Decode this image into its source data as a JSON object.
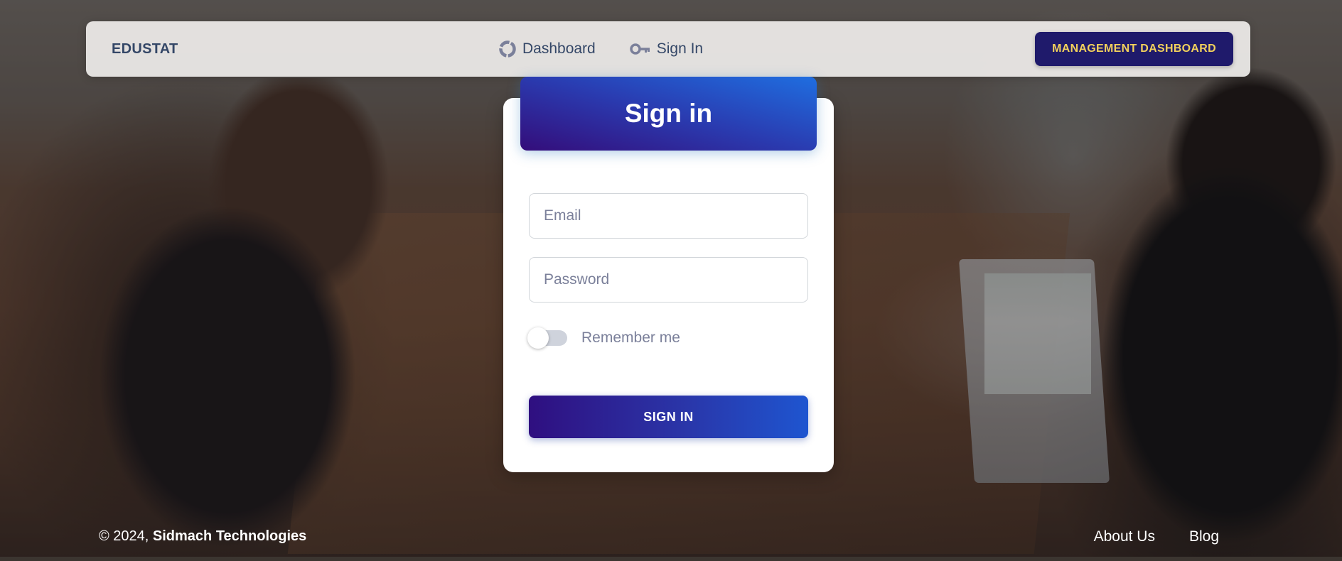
{
  "navbar": {
    "brand": "EDUSTAT",
    "links": [
      {
        "label": "Dashboard",
        "icon": "donut-chart-icon"
      },
      {
        "label": "Sign In",
        "icon": "key-icon"
      }
    ],
    "management_button": "MANAGEMENT DASHBOARD"
  },
  "card": {
    "title": "Sign in",
    "email_placeholder": "Email",
    "password_placeholder": "Password",
    "remember_label": "Remember me",
    "remember_on": false,
    "submit_label": "SIGN IN"
  },
  "footer": {
    "copyright_prefix": "© 2024,",
    "company": "Sidmach Technologies",
    "links": [
      "About Us",
      "Blog"
    ]
  },
  "colors": {
    "brand_text": "#344767",
    "management_button_bg": "#1f1a6b",
    "management_button_text": "#f2d15c",
    "card_header_gradient": [
      "#1f6ee0",
      "#340d7a"
    ],
    "submit_gradient": [
      "#2f0f80",
      "#1e55d0"
    ]
  }
}
